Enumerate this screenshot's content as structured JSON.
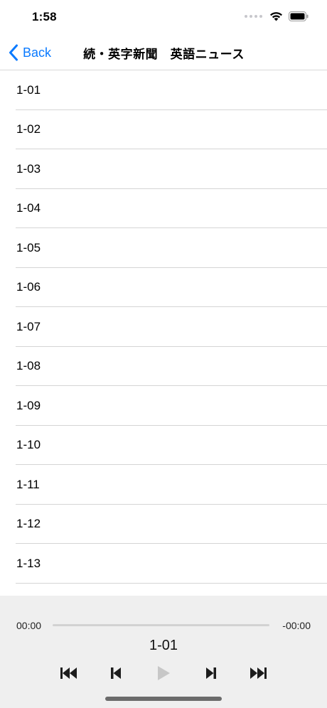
{
  "status_bar": {
    "time": "1:58"
  },
  "nav": {
    "back_label": "Back",
    "title": "続・英字新聞　英語ニュース"
  },
  "tracks": [
    "1-01",
    "1-02",
    "1-03",
    "1-04",
    "1-05",
    "1-06",
    "1-07",
    "1-08",
    "1-09",
    "1-10",
    "1-11",
    "1-12",
    "1-13"
  ],
  "player": {
    "elapsed": "00:00",
    "remaining": "-00:00",
    "now_playing": "1-01",
    "progress": 0,
    "play_enabled": false
  },
  "colors": {
    "accent": "#0a7aff",
    "player_bg": "#efefef",
    "disabled_icon": "#c7c7c7",
    "icon": "#1c1c1c"
  }
}
